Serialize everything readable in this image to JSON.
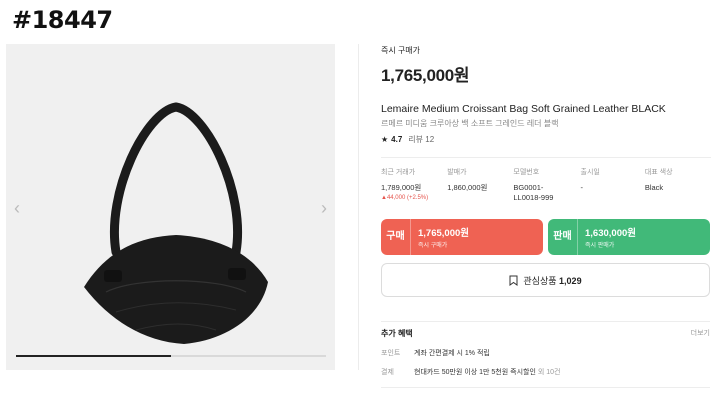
{
  "tag": "#18447",
  "gallery": {
    "prev_icon": "chevron-left-icon",
    "next_icon": "chevron-right-icon",
    "progress": 0.5,
    "colors": {
      "background": "#f0f0f0",
      "bag": "#1b1b1b"
    }
  },
  "product": {
    "buy_now_label": "즉시 구매가",
    "price": "1,765,000원",
    "title": "Lemaire Medium Croissant Bag Soft Grained Leather BLACK",
    "subtitle": "르메르 미디움 크루아상 백 소프트 그레인드 레더 블랙",
    "rating": "4.7",
    "reviews": "리뷰 12"
  },
  "specs": [
    {
      "key": "최근 거래가",
      "value": "1,789,000원",
      "sub": "▲44,000 (+2.5%)"
    },
    {
      "key": "발매가",
      "value": "1,860,000원",
      "sub": ""
    },
    {
      "key": "모델번호",
      "value": "BG0001-\nLL0018-999",
      "sub": ""
    },
    {
      "key": "출시일",
      "value": "-",
      "sub": ""
    },
    {
      "key": "대표 색상",
      "value": "Black",
      "sub": ""
    }
  ],
  "actions": {
    "buy": {
      "kind": "구매",
      "amount": "1,765,000원",
      "note": "즉시 구매가",
      "color": "#ef6253"
    },
    "sell": {
      "kind": "판매",
      "amount": "1,630,000원",
      "note": "즉시 판매가",
      "color": "#41b979"
    }
  },
  "wish": {
    "icon": "bookmark-icon",
    "label": "관심상품",
    "count": "1,029"
  },
  "benefits": {
    "title": "추가 혜택",
    "more": "더보기",
    "rows": [
      {
        "key": "포인트",
        "value": "계좌 간편결제 시 1% 적립",
        "extra": ""
      },
      {
        "key": "결제",
        "value": "현대카드 50만원 이상 1만 5천원 즉시할인",
        "extra": "외 10건"
      }
    ]
  }
}
